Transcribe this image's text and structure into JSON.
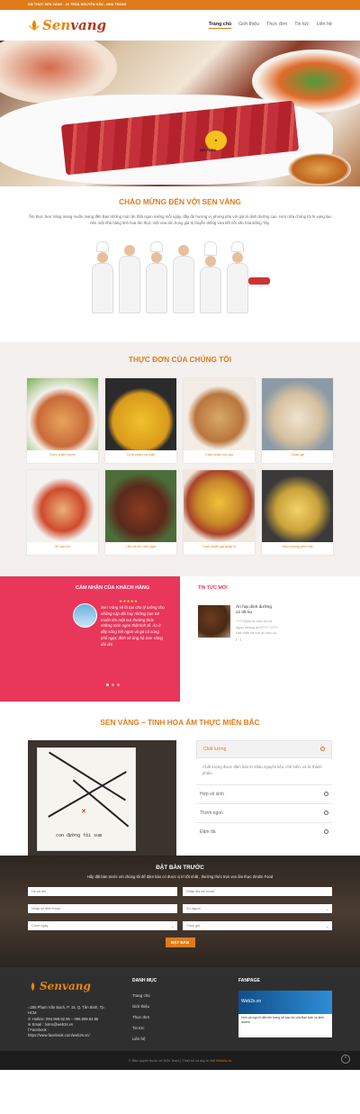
{
  "topbar": {
    "text": "ẨM THỰC SEN VÀNG - 20 TRẦN NGUYÊN HÃN - NHA TRANG"
  },
  "brand": {
    "name_a": "Sen",
    "name_b": "vang",
    "accent": "#e07b1a",
    "pink": "#e8375a"
  },
  "nav": [
    "Trang chủ",
    "Giới thiệu",
    "Thực đơn",
    "Tin tức",
    "Liên hệ"
  ],
  "hero": {
    "badge": "MR.PARK"
  },
  "welcome": {
    "title": "CHÀO MỪNG ĐẾN VỚI SEN VÀNG",
    "text": "Ẩm thực Sen Vàng mong muốn mang đến Bạn những món ăn thật ngon miệng mỗi ngày, đầy đủ hương vị, phong phú với giá trị dinh dưỡng cao. Hơn nữa chúng tôi hi vọng tạo nên một nhà hàng tinh hoa ẩm thực Việt vừa tôn trọng giá trị truyền thống vừa kết nối văn hóa Đông Tây."
  },
  "menu": {
    "title": "THỰC ĐƠN CỦA CHÚNG TÔI",
    "items": [
      "Cơm chiên nước",
      "Cơm chiên cá mặn",
      "Cơm chiên bò cầu",
      "Cháo gà",
      "Mì xào bò",
      "Lẩu cá mú nấu ngót",
      "Cơm chiên gà quay lu",
      "Hấu nướng phô mai"
    ]
  },
  "testimonial": {
    "title": "CẢM NHẬN CỦA KHÁCH HÀNG",
    "stars": "★★★★★",
    "quote": "Sen Vàng sẽ là tạo cho lý tưởng cho những cặp đôi hay những bạn trẻ muốn tìm một nơi thưởng thức những món ngon thật tinh tế. Ăn ở đây sống hết ngon và gà cũ cùng phổ ngọt; đỉnh sẽ ủng hộ Sen Vàng dài dài"
  },
  "news": {
    "title": "TIN TỨC MỚI",
    "item_title": "Ăn hạt dinh dưỡng có tốt ko",
    "item_summary": "????Quả óc chó ăn có ngon không em???? ????Hạt mắc ca với óc chó có [...]"
  },
  "about": {
    "title": "SEN VÀNG – TINH HOA ẨM THỰC MIỀN BẮC",
    "map_label": "con đường tôi sum",
    "acc_open": "Chất lượng",
    "acc_body": "Chất lượng được đảm bảo từ khâu nguyên liệu, chế biến, và từ thành phẩm",
    "acc_rows": [
      "Hợp vệ sinh",
      "Thơm ngon",
      "Đậm đà"
    ]
  },
  "reserve": {
    "title": "ĐẶT BÀN TRƯỚC",
    "text": "Hãy đặt bàn trước với chúng tôi để đảm bảo có được vị trí tốt nhất , thưởng thức trọn vẹn ẩm thực ZinZin Food",
    "fields": [
      "Họ và tên",
      "Nhập địa chỉ email",
      "Nhập số điện thoại",
      "Số người",
      "Chọn ngày",
      "Chọn giờ"
    ],
    "button": "ĐẶT BÀN"
  },
  "footer": {
    "address": "285 Phạm Văn Bạch, P. 15, Q. Tân Bình, Tp. HCM",
    "hotline": "Hotline: 094.999.92.95 – 096.999.92.95",
    "email": "Email : hotro@web2s.vn",
    "facebook": "Facebook :",
    "facebook_url": "https://www.facebook.com/web2s.vn/",
    "menu_title": "DANH MỤC",
    "menu_items": [
      "Trang chủ",
      "Giới thiệu",
      "Thực đơn",
      "Tin tức",
      "Liên hệ"
    ],
    "fanpage_title": "FANPAGE",
    "fanpage_name": "Web2s.vn",
    "fanpage_text": "Hơn cả người dẫn lên trang sẽ bao bò của Bạn bán và kinh doanh"
  },
  "copyright": {
    "text": "© Bản quyền thuộc về W2s Team | Thiết kế và duy trì bởi",
    "brand": "Web2s.vn"
  }
}
